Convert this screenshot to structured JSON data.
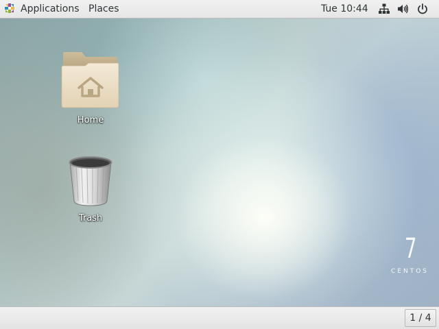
{
  "topbar": {
    "applications_label": "Applications",
    "places_label": "Places",
    "clock": "Tue 10:44",
    "icons": [
      "centos-logo-icon",
      "network-icon",
      "volume-icon",
      "power-icon"
    ]
  },
  "desktop": {
    "icons": [
      {
        "label": "Home",
        "icon": "home-folder-icon"
      },
      {
        "label": "Trash",
        "icon": "trash-icon"
      }
    ],
    "wallpaper_brand": {
      "version": "7",
      "name": "CENTOS"
    }
  },
  "bottombar": {
    "workspace_indicator": "1 / 4"
  },
  "colors": {
    "panel_bg": "#e8e8e8",
    "panel_text": "#2e3436",
    "folder": "#e9dcc4",
    "label_text": "#ffffff"
  }
}
